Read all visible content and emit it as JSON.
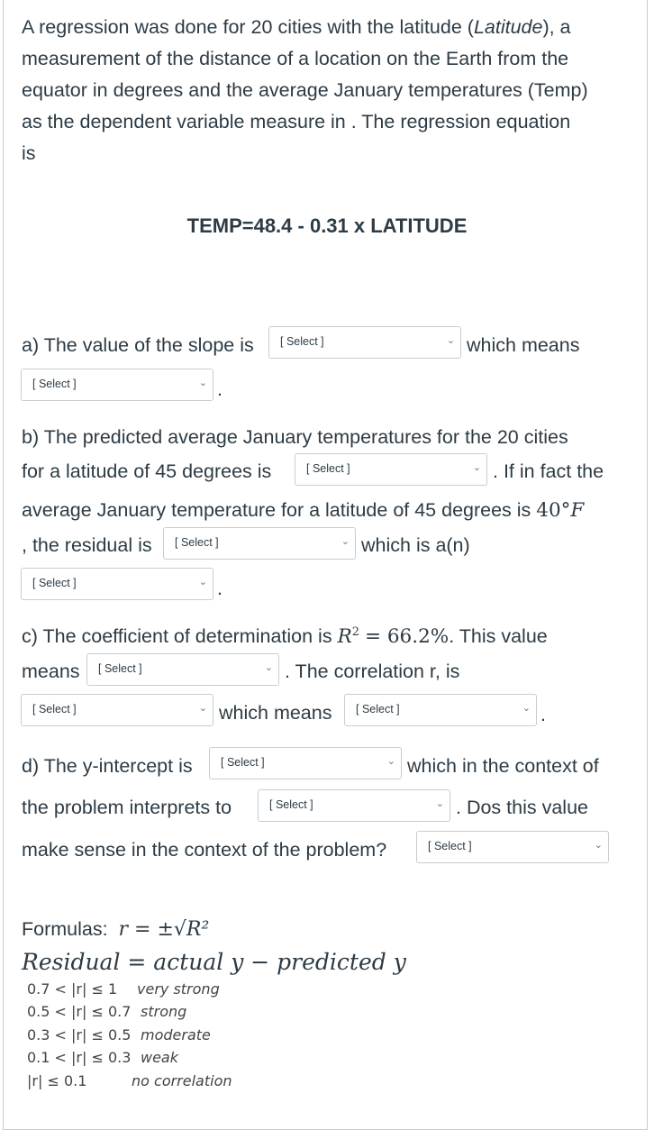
{
  "intro": {
    "lines": [
      "A regression was done for 20 cities with the latitude (",
      "measurement of the distance of a location on the Earth from the",
      "equator in degrees and the average January temperatures (Temp)",
      "as the dependent variable measure in .  The regression equation",
      "is"
    ],
    "latitude_italic": "Latitude",
    "line1_tail": "), a"
  },
  "equation": "TEMP=48.4 - 0.31 x LATITUDE",
  "select_placeholder": "[ Select ]",
  "part_a": {
    "text1": "a) The value of the slope is",
    "text2": "which means",
    "text3": "."
  },
  "part_b": {
    "line1": "b) The predicted average January temperatures for the 20 cities",
    "text1": "for a latitude of 45 degrees is",
    "text2": ". If in fact the",
    "line3": "average January temperature for a latitude of 45 degrees is",
    "temp_value": "40°",
    "temp_unit": "F",
    "text4": ", the residual is",
    "text5": "which is a(n)",
    "text6": "."
  },
  "part_c": {
    "text1": "c) The coefficient of determination is",
    "r2_symbol": "R",
    "r2_exp": "2",
    "r2_value": "= 66.2%",
    "text2": ". This value",
    "text3": "means",
    "text4": ". The correlation r, is",
    "text5": "which means",
    "text6": "."
  },
  "part_d": {
    "text1": "d) The y-intercept is",
    "text2": "which in the context of",
    "text3": "the problem interprets to",
    "text4": ". Dos this value",
    "text5": "make sense in the context of the problem?"
  },
  "formulas": {
    "label": "Formulas:",
    "r_formula": "r = ±√R²",
    "residual_formula": "Residual = actual y − predicted y",
    "table": [
      {
        "range": "0.7 < |r| ≤ 1",
        "desc": "very strong"
      },
      {
        "range": "0.5 < |r| ≤ 0.7",
        "desc": "strong"
      },
      {
        "range": "0.3 < |r| ≤ 0.5",
        "desc": "moderate"
      },
      {
        "range": "0.1 < |r| ≤ 0.3",
        "desc": "weak"
      },
      {
        "range": "|r| ≤ 0.1",
        "desc": "no correlation"
      }
    ]
  }
}
